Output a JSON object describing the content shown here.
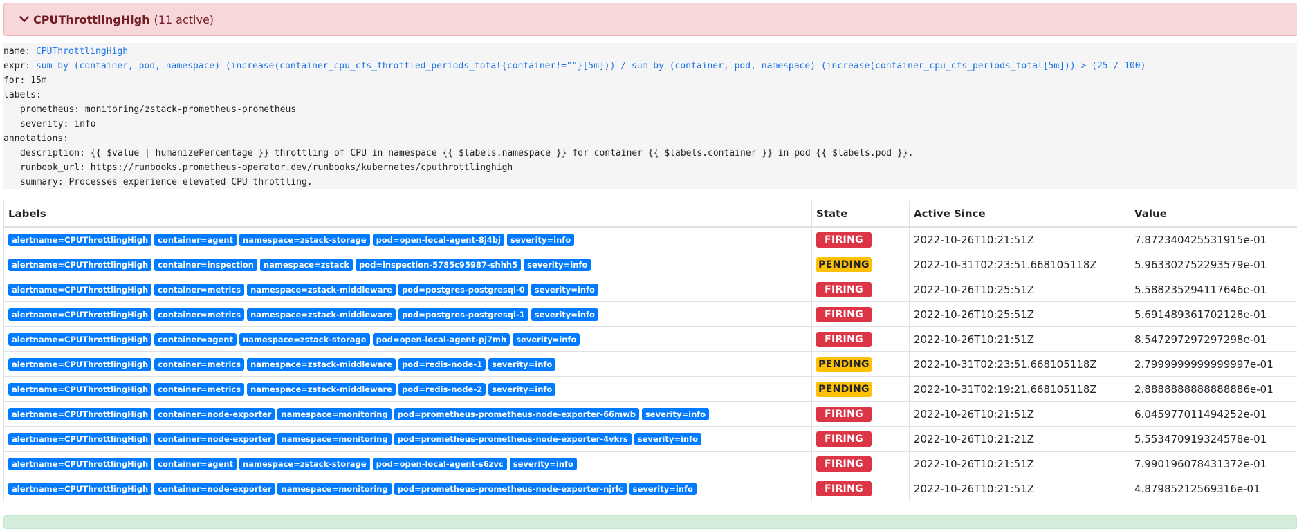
{
  "group": {
    "name": "CPUThrottlingHigh",
    "count_text": "(11 active)",
    "header_color": "#f8d7da"
  },
  "rule": {
    "name_key": "name:",
    "name_value": "CPUThrottlingHigh",
    "expr_key": "expr:",
    "expr_value": "sum by (container, pod, namespace) (increase(container_cpu_cfs_throttled_periods_total{container!=\"\"}[5m])) / sum by (container, pod, namespace) (increase(container_cpu_cfs_periods_total[5m])) > (25 / 100)",
    "for_line": "for: 15m",
    "labels_key": "labels:",
    "prometheus_line": "prometheus: monitoring/zstack-prometheus-prometheus",
    "severity_line": "severity: info",
    "annotations_key": "annotations:",
    "description_line": "description: {{ $value | humanizePercentage }} throttling of CPU in namespace {{ $labels.namespace }} for container {{ $labels.container }} in pod {{ $labels.pod }}.",
    "runbook_line": "runbook_url: https://runbooks.prometheus-operator.dev/runbooks/kubernetes/cputhrottlinghigh",
    "summary_line": "summary: Processes experience elevated CPU throttling."
  },
  "table": {
    "headers": {
      "labels": "Labels",
      "state": "State",
      "active_since": "Active Since",
      "value": "Value"
    },
    "rows": [
      {
        "labels": [
          "alertname=CPUThrottlingHigh",
          "container=agent",
          "namespace=zstack-storage",
          "pod=open-local-agent-8j4bj",
          "severity=info"
        ],
        "state": "FIRING",
        "active_since": "2022-10-26T10:21:51Z",
        "value": "7.872340425531915e-01"
      },
      {
        "labels": [
          "alertname=CPUThrottlingHigh",
          "container=inspection",
          "namespace=zstack",
          "pod=inspection-5785c95987-shhh5",
          "severity=info"
        ],
        "state": "PENDING",
        "active_since": "2022-10-31T02:23:51.668105118Z",
        "value": "5.963302752293579e-01"
      },
      {
        "labels": [
          "alertname=CPUThrottlingHigh",
          "container=metrics",
          "namespace=zstack-middleware",
          "pod=postgres-postgresql-0",
          "severity=info"
        ],
        "state": "FIRING",
        "active_since": "2022-10-26T10:25:51Z",
        "value": "5.588235294117646e-01"
      },
      {
        "labels": [
          "alertname=CPUThrottlingHigh",
          "container=metrics",
          "namespace=zstack-middleware",
          "pod=postgres-postgresql-1",
          "severity=info"
        ],
        "state": "FIRING",
        "active_since": "2022-10-26T10:25:51Z",
        "value": "5.691489361702128e-01"
      },
      {
        "labels": [
          "alertname=CPUThrottlingHigh",
          "container=agent",
          "namespace=zstack-storage",
          "pod=open-local-agent-pj7mh",
          "severity=info"
        ],
        "state": "FIRING",
        "active_since": "2022-10-26T10:21:51Z",
        "value": "8.547297297297298e-01"
      },
      {
        "labels": [
          "alertname=CPUThrottlingHigh",
          "container=metrics",
          "namespace=zstack-middleware",
          "pod=redis-node-1",
          "severity=info"
        ],
        "state": "PENDING",
        "active_since": "2022-10-31T02:23:51.668105118Z",
        "value": "2.7999999999999997e-01"
      },
      {
        "labels": [
          "alertname=CPUThrottlingHigh",
          "container=metrics",
          "namespace=zstack-middleware",
          "pod=redis-node-2",
          "severity=info"
        ],
        "state": "PENDING",
        "active_since": "2022-10-31T02:19:21.668105118Z",
        "value": "2.8888888888888886e-01"
      },
      {
        "labels": [
          "alertname=CPUThrottlingHigh",
          "container=node-exporter",
          "namespace=monitoring",
          "pod=prometheus-prometheus-node-exporter-66mwb",
          "severity=info"
        ],
        "state": "FIRING",
        "active_since": "2022-10-26T10:21:51Z",
        "value": "6.045977011494252e-01"
      },
      {
        "labels": [
          "alertname=CPUThrottlingHigh",
          "container=node-exporter",
          "namespace=monitoring",
          "pod=prometheus-prometheus-node-exporter-4vkrs",
          "severity=info"
        ],
        "state": "FIRING",
        "active_since": "2022-10-26T10:21:21Z",
        "value": "5.553470919324578e-01"
      },
      {
        "labels": [
          "alertname=CPUThrottlingHigh",
          "container=agent",
          "namespace=zstack-storage",
          "pod=open-local-agent-s6zvc",
          "severity=info"
        ],
        "state": "FIRING",
        "active_since": "2022-10-26T10:21:51Z",
        "value": "7.990196078431372e-01"
      },
      {
        "labels": [
          "alertname=CPUThrottlingHigh",
          "container=node-exporter",
          "namespace=monitoring",
          "pod=prometheus-prometheus-node-exporter-njrlc",
          "severity=info"
        ],
        "state": "FIRING",
        "active_since": "2022-10-26T10:21:51Z",
        "value": "4.87985212569316e-01"
      }
    ]
  },
  "colors": {
    "label_badge": "#007bff",
    "firing": "#dc3545",
    "pending": "#ffc107"
  },
  "icons": {
    "collapse": "chevron-down-icon"
  }
}
